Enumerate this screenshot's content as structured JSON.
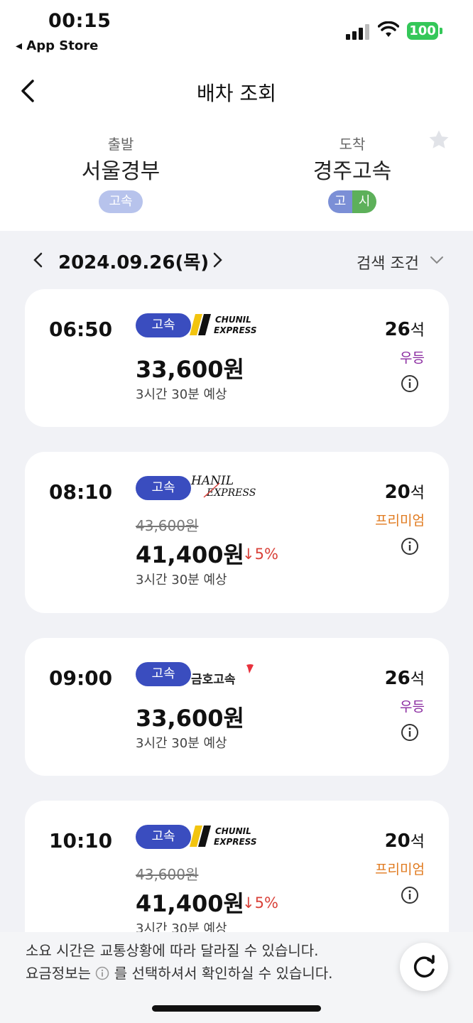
{
  "status_bar": {
    "time": "00:15",
    "back_app": "◂ App Store",
    "battery": "100"
  },
  "header": {
    "title": "배차 조회"
  },
  "route": {
    "departure": {
      "label": "출발",
      "name": "서울경부",
      "badge": "고속"
    },
    "arrival": {
      "label": "도착",
      "name": "경주고속",
      "badge_left": "고",
      "badge_right": "시"
    }
  },
  "date_bar": {
    "date": "2024.09.26(목)",
    "filter_label": "검색 조건"
  },
  "schedules": [
    {
      "time": "06:50",
      "type": "고속",
      "company": "CHUNIL EXPRESS",
      "old_price": "",
      "price": "33,600원",
      "discount": "",
      "duration": "3시간 30분 예상",
      "seats": "26",
      "seat_unit": "석",
      "grade": "우등"
    },
    {
      "time": "08:10",
      "type": "고속",
      "company": "HANIL EXPRESS",
      "old_price": "43,600원",
      "price": "41,400원",
      "discount": "↓5%",
      "duration": "3시간 30분 예상",
      "seats": "20",
      "seat_unit": "석",
      "grade": "프리미엄"
    },
    {
      "time": "09:00",
      "type": "고속",
      "company": "금호고속",
      "old_price": "",
      "price": "33,600원",
      "discount": "",
      "duration": "3시간 30분 예상",
      "seats": "26",
      "seat_unit": "석",
      "grade": "우등"
    },
    {
      "time": "10:10",
      "type": "고속",
      "company": "CHUNIL EXPRESS",
      "old_price": "43,600원",
      "price": "41,400원",
      "discount": "↓5%",
      "duration": "3시간 30분 예상",
      "seats": "20",
      "seat_unit": "석",
      "grade": "프리미엄"
    }
  ],
  "notice": {
    "line1": "소요 시간은 교통상황에 따라 달라질 수 있습니다.",
    "line2_before": "요금정보는",
    "line2_after": "를 선택하셔서 확인하실 수 있습니다."
  },
  "colors": {
    "express_tag": "#3a4dbf",
    "grade_udeung": "#8a2aa0",
    "grade_premium": "#e07a1f",
    "discount": "#d9423a",
    "list_bg": "#f1f2f6"
  }
}
